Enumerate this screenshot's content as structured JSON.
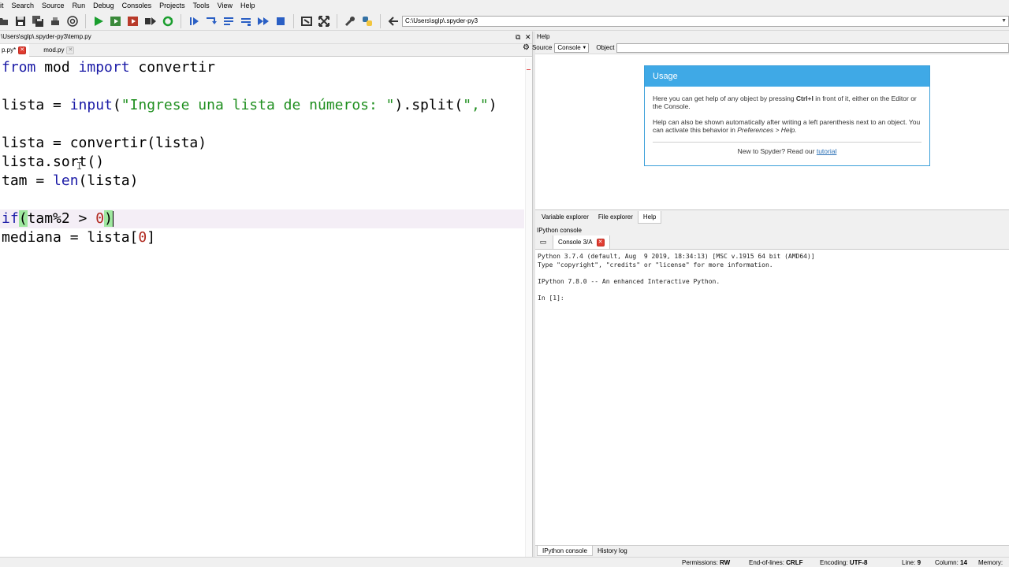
{
  "menu": [
    "lit",
    "Search",
    "Source",
    "Run",
    "Debug",
    "Consoles",
    "Projects",
    "Tools",
    "View",
    "Help"
  ],
  "toolbar": {
    "working_dir": "C:\\Users\\sglp\\.spyder-py3"
  },
  "editor": {
    "path": "\\Users\\sglp\\.spyder-py3\\temp.py",
    "tabs": [
      {
        "label": "p.py*",
        "active": true
      },
      {
        "label": "mod.py",
        "active": false
      }
    ]
  },
  "code": {
    "line1": {
      "kw1": "from",
      "mid": " mod ",
      "kw2": "import",
      "rest": " convertir"
    },
    "line3": {
      "a": "lista = ",
      "fn": "input",
      "b": "(",
      "str1": "\"Ingrese una lista de números: \"",
      "c": ").split(",
      "str2": "\",\"",
      "d": ")"
    },
    "line5": {
      "a": "lista = convertir(lista)"
    },
    "line6": {
      "a": "lista.sort()"
    },
    "line7": {
      "a": "tam = ",
      "fn": "len",
      "b": "(lista)"
    },
    "line9": {
      "kw": "if",
      "p1": "(",
      "a": "tam%2 > ",
      "num": "0",
      "p2": ")"
    },
    "line10": {
      "a": "mediana = lista[",
      "num": "0",
      "b": "]"
    }
  },
  "help": {
    "title": "Help",
    "source_label": "Source",
    "source_value": "Console",
    "object_label": "Object",
    "usage_title": "Usage",
    "para1_a": "Here you can get help of any object by pressing ",
    "para1_b": "Ctrl+I",
    "para1_c": " in front of it, either on the Editor or the Console.",
    "para2_a": "Help can also be shown automatically after writing a left parenthesis next to an object. You can activate this behavior in ",
    "para2_b": "Preferences > Help.",
    "new_a": "New to Spyder? Read our ",
    "new_link": "tutorial",
    "tabs": [
      "Variable explorer",
      "File explorer",
      "Help"
    ]
  },
  "console": {
    "title": "IPython console",
    "tab_label": "Console 3/A",
    "line1": "Python 3.7.4 (default, Aug  9 2019, 18:34:13) [MSC v.1915 64 bit (AMD64)]",
    "line2": "Type \"copyright\", \"credits\" or \"license\" for more information.",
    "line3": "IPython 7.8.0 -- An enhanced Interactive Python.",
    "line4": "In [1]:",
    "bottom_tabs": [
      "IPython console",
      "History log"
    ]
  },
  "status": {
    "permissions_label": "Permissions:",
    "permissions_value": "RW",
    "eol_label": "End-of-lines:",
    "eol_value": "CRLF",
    "encoding_label": "Encoding:",
    "encoding_value": "UTF-8",
    "line_label": "Line:",
    "line_value": "9",
    "column_label": "Column:",
    "column_value": "14",
    "memory_label": "Memory:"
  }
}
